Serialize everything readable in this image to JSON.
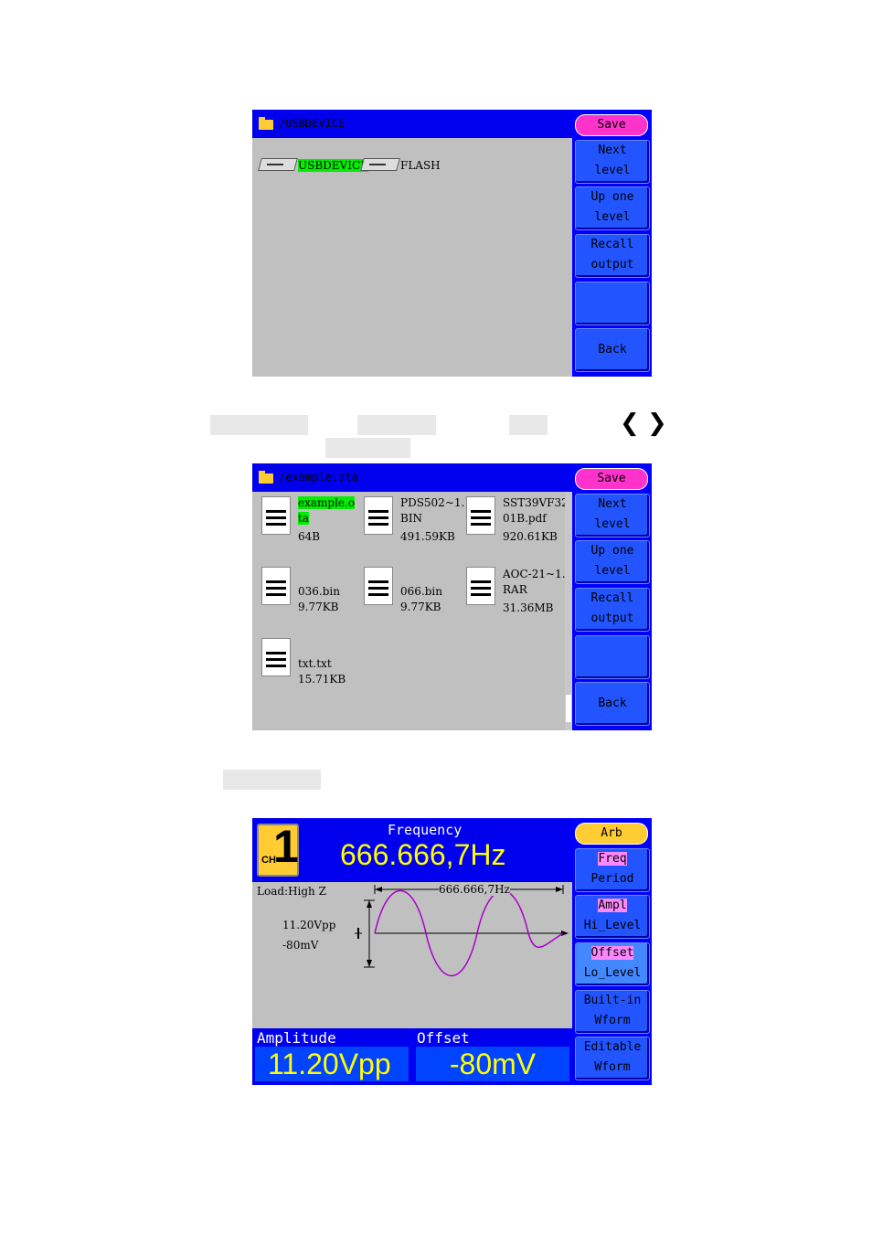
{
  "screen1": {
    "title": "/USBDEVICE",
    "drives": [
      {
        "label": "USBDEVICE",
        "selected": true
      },
      {
        "label": "FLASH",
        "selected": false
      }
    ],
    "buttons": {
      "save": "Save",
      "next_level": [
        "Next",
        "level"
      ],
      "up_one_level": [
        "Up  one",
        "level"
      ],
      "recall_output": [
        "Recall",
        "output"
      ],
      "blank": "",
      "back": "Back"
    }
  },
  "instruction_arrows": {
    "left": "❮",
    "right": "❯"
  },
  "screen2": {
    "title": "/example.ota",
    "files": [
      {
        "name_line1": "example.o",
        "name_line2": "ta",
        "size": "64B",
        "selected": true
      },
      {
        "name_line1": "PDS502~1.",
        "name_line2": "BIN",
        "size": "491.59KB",
        "selected": false
      },
      {
        "name_line1": "SST39VF32",
        "name_line2": "01B.pdf",
        "size": "920.61KB",
        "selected": false
      },
      {
        "name_line1": "036.bin",
        "name_line2": "9.77KB",
        "size": "",
        "selected": false
      },
      {
        "name_line1": "066.bin",
        "name_line2": "9.77KB",
        "size": "",
        "selected": false
      },
      {
        "name_line1": "AOC-21~1.",
        "name_line2": "RAR",
        "size": "31.36MB",
        "selected": false
      },
      {
        "name_line1": "txt.txt",
        "name_line2": "15.71KB",
        "size": "",
        "selected": false
      }
    ],
    "buttons": {
      "save": "Save",
      "next_level": [
        "Next",
        "level"
      ],
      "up_one_level": [
        "Up  one",
        "level"
      ],
      "recall_output": [
        "Recall",
        "output"
      ],
      "blank": "",
      "back": "Back"
    }
  },
  "screen3": {
    "channel": {
      "prefix": "CH",
      "number": "1"
    },
    "frequency_label": "Frequency",
    "frequency_value": "666.666,7Hz",
    "load": "Load:High Z",
    "period_marker": "666.666,7Hz",
    "amplitude_small": "11.20Vpp",
    "offset_small": "-80mV",
    "amplitude_label": "Amplitude",
    "amplitude_value": "11.20Vpp",
    "offset_label": "Offset",
    "offset_value": "-80mV",
    "buttons": {
      "arb": "Arb",
      "freq_period": [
        "Freq",
        "Period"
      ],
      "ampl_hilevel": [
        "Ampl",
        "Hi_Level"
      ],
      "offset_lolevel": [
        "Offset",
        "Lo_Level"
      ],
      "builtin": [
        "Built-in",
        "Wform"
      ],
      "editable": [
        "Editable",
        "Wform"
      ]
    },
    "colors": {
      "wave": "#aa00cc",
      "highlight": "#ff88ff",
      "value": "#ffff00"
    }
  }
}
